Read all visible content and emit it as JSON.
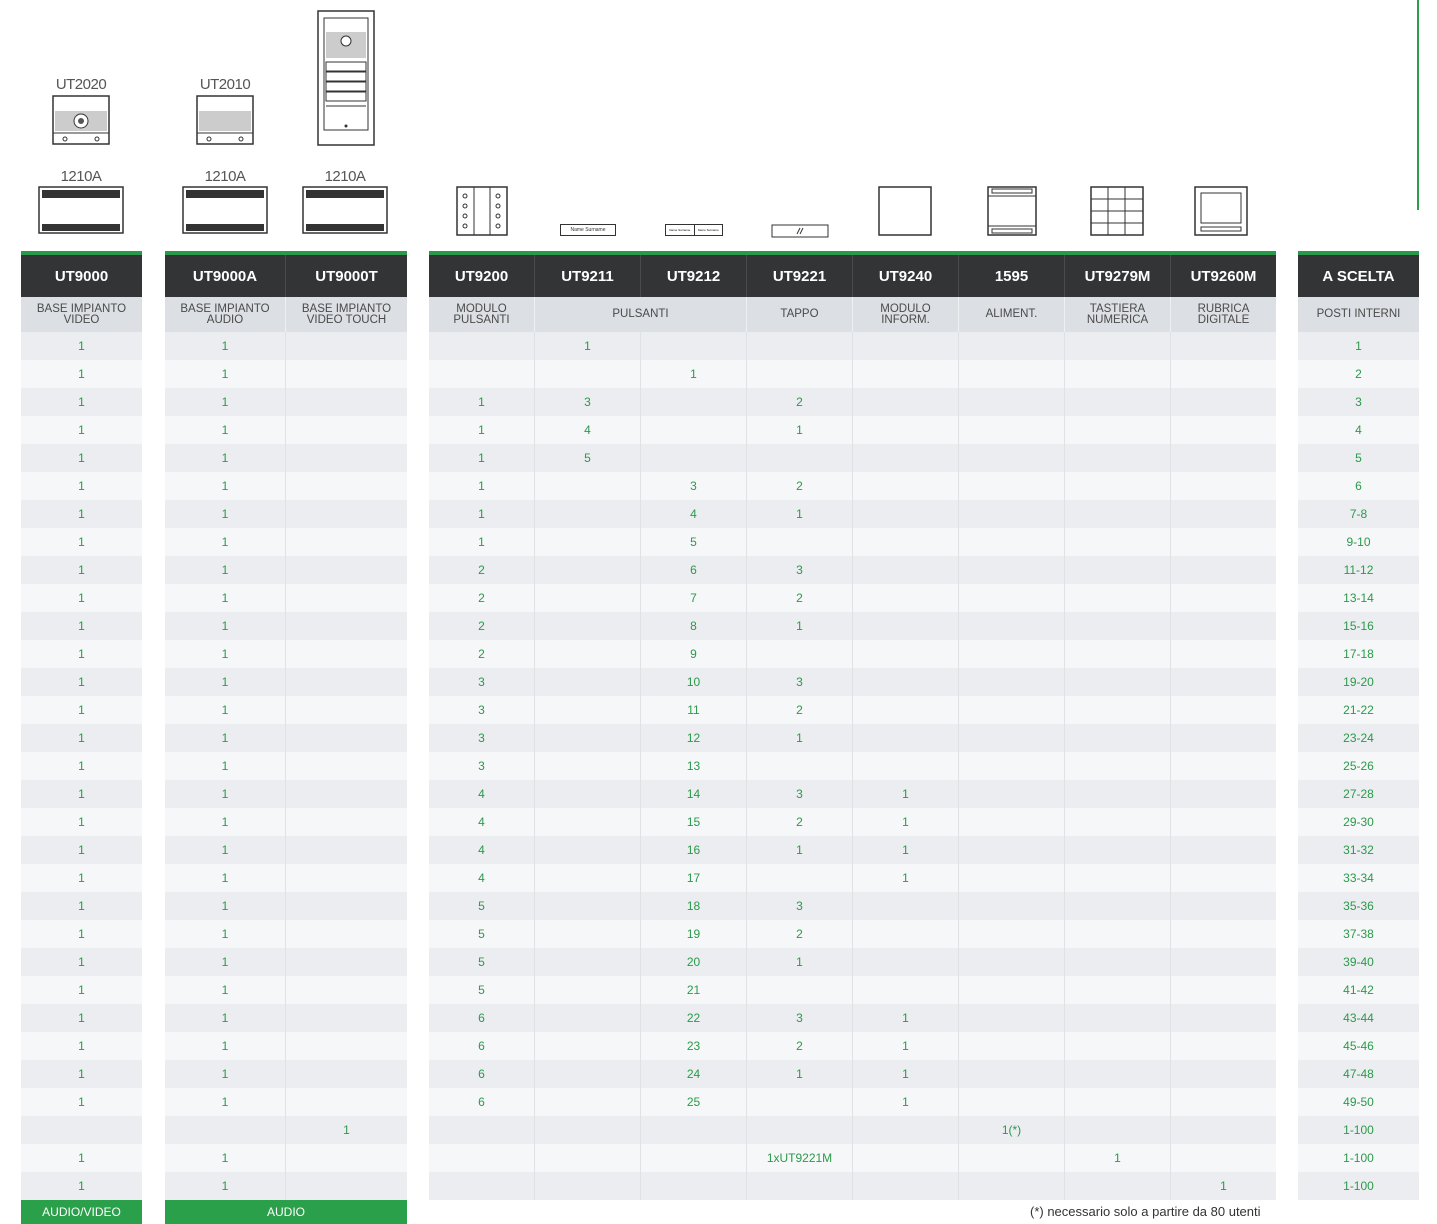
{
  "products_top": {
    "p1_label": "UT2020",
    "p2_label": "UT2010",
    "ps1": "1210A",
    "ps2": "1210A",
    "ps3": "1210A",
    "nameplate": "Name Surname",
    "nameplate_small": "Name Surname"
  },
  "block1": {
    "headers": [
      "UT9000"
    ],
    "subs": [
      "BASE IMPIANTO VIDEO"
    ],
    "rows": [
      [
        "1"
      ],
      [
        "1"
      ],
      [
        "1"
      ],
      [
        "1"
      ],
      [
        "1"
      ],
      [
        "1"
      ],
      [
        "1"
      ],
      [
        "1"
      ],
      [
        "1"
      ],
      [
        "1"
      ],
      [
        "1"
      ],
      [
        "1"
      ],
      [
        "1"
      ],
      [
        "1"
      ],
      [
        "1"
      ],
      [
        "1"
      ],
      [
        "1"
      ],
      [
        "1"
      ],
      [
        "1"
      ],
      [
        "1"
      ],
      [
        "1"
      ],
      [
        "1"
      ],
      [
        "1"
      ],
      [
        "1"
      ],
      [
        "1"
      ],
      [
        "1"
      ],
      [
        "1"
      ],
      [
        "1"
      ],
      [
        ""
      ],
      [
        "1"
      ],
      [
        "1"
      ]
    ],
    "footer": "AUDIO/VIDEO"
  },
  "block2": {
    "headers": [
      "UT9000A",
      "UT9000T"
    ],
    "subs": [
      "BASE IMPIANTO AUDIO",
      "BASE IMPIANTO VIDEO TOUCH"
    ],
    "rows": [
      [
        "1",
        ""
      ],
      [
        "1",
        ""
      ],
      [
        "1",
        ""
      ],
      [
        "1",
        ""
      ],
      [
        "1",
        ""
      ],
      [
        "1",
        ""
      ],
      [
        "1",
        ""
      ],
      [
        "1",
        ""
      ],
      [
        "1",
        ""
      ],
      [
        "1",
        ""
      ],
      [
        "1",
        ""
      ],
      [
        "1",
        ""
      ],
      [
        "1",
        ""
      ],
      [
        "1",
        ""
      ],
      [
        "1",
        ""
      ],
      [
        "1",
        ""
      ],
      [
        "1",
        ""
      ],
      [
        "1",
        ""
      ],
      [
        "1",
        ""
      ],
      [
        "1",
        ""
      ],
      [
        "1",
        ""
      ],
      [
        "1",
        ""
      ],
      [
        "1",
        ""
      ],
      [
        "1",
        ""
      ],
      [
        "1",
        ""
      ],
      [
        "1",
        ""
      ],
      [
        "1",
        ""
      ],
      [
        "1",
        ""
      ],
      [
        "",
        "1"
      ],
      [
        "1",
        ""
      ],
      [
        "1",
        ""
      ]
    ],
    "footer": "AUDIO"
  },
  "block3": {
    "headers": [
      "UT9200",
      "UT9211",
      "UT9212",
      "UT9221",
      "UT9240",
      "1595",
      "UT9279M",
      "UT9260M"
    ],
    "subs": [
      "MODULO PULSANTI",
      "PULSANTI",
      "TAPPO",
      "MODULO INFORM.",
      "ALIMENT.",
      "TASTIERA NUMERICA",
      "RUBRICA DIGITALE"
    ],
    "rows": [
      [
        "",
        "1",
        "",
        "",
        "",
        "",
        "",
        ""
      ],
      [
        "",
        "",
        "1",
        "",
        "",
        "",
        "",
        ""
      ],
      [
        "1",
        "3",
        "",
        "2",
        "",
        "",
        "",
        ""
      ],
      [
        "1",
        "4",
        "",
        "1",
        "",
        "",
        "",
        ""
      ],
      [
        "1",
        "5",
        "",
        "",
        "",
        "",
        "",
        ""
      ],
      [
        "1",
        "",
        "3",
        "2",
        "",
        "",
        "",
        ""
      ],
      [
        "1",
        "",
        "4",
        "1",
        "",
        "",
        "",
        ""
      ],
      [
        "1",
        "",
        "5",
        "",
        "",
        "",
        "",
        ""
      ],
      [
        "2",
        "",
        "6",
        "3",
        "",
        "",
        "",
        ""
      ],
      [
        "2",
        "",
        "7",
        "2",
        "",
        "",
        "",
        ""
      ],
      [
        "2",
        "",
        "8",
        "1",
        "",
        "",
        "",
        ""
      ],
      [
        "2",
        "",
        "9",
        "",
        "",
        "",
        "",
        ""
      ],
      [
        "3",
        "",
        "10",
        "3",
        "",
        "",
        "",
        ""
      ],
      [
        "3",
        "",
        "11",
        "2",
        "",
        "",
        "",
        ""
      ],
      [
        "3",
        "",
        "12",
        "1",
        "",
        "",
        "",
        ""
      ],
      [
        "3",
        "",
        "13",
        "",
        "",
        "",
        "",
        ""
      ],
      [
        "4",
        "",
        "14",
        "3",
        "1",
        "",
        "",
        ""
      ],
      [
        "4",
        "",
        "15",
        "2",
        "1",
        "",
        "",
        ""
      ],
      [
        "4",
        "",
        "16",
        "1",
        "1",
        "",
        "",
        ""
      ],
      [
        "4",
        "",
        "17",
        "",
        "1",
        "",
        "",
        ""
      ],
      [
        "5",
        "",
        "18",
        "3",
        "",
        "",
        "",
        ""
      ],
      [
        "5",
        "",
        "19",
        "2",
        "",
        "",
        "",
        ""
      ],
      [
        "5",
        "",
        "20",
        "1",
        "",
        "",
        "",
        ""
      ],
      [
        "5",
        "",
        "21",
        "",
        "",
        "",
        "",
        ""
      ],
      [
        "6",
        "",
        "22",
        "3",
        "1",
        "",
        "",
        ""
      ],
      [
        "6",
        "",
        "23",
        "2",
        "1",
        "",
        "",
        ""
      ],
      [
        "6",
        "",
        "24",
        "1",
        "1",
        "",
        "",
        ""
      ],
      [
        "6",
        "",
        "25",
        "",
        "1",
        "",
        "",
        ""
      ],
      [
        "",
        "",
        "",
        "",
        "",
        "1(*)",
        "",
        ""
      ],
      [
        "",
        "",
        "",
        "1xUT9221M",
        "",
        "",
        "1",
        ""
      ],
      [
        "",
        "",
        "",
        "",
        "",
        "",
        "",
        "1"
      ]
    ],
    "note": "(*) necessario solo a partire da 80 utenti"
  },
  "block4": {
    "headers": [
      "A SCELTA"
    ],
    "subs": [
      "POSTI INTERNI"
    ],
    "rows": [
      [
        "1"
      ],
      [
        "2"
      ],
      [
        "3"
      ],
      [
        "4"
      ],
      [
        "5"
      ],
      [
        "6"
      ],
      [
        "7-8"
      ],
      [
        "9-10"
      ],
      [
        "11-12"
      ],
      [
        "13-14"
      ],
      [
        "15-16"
      ],
      [
        "17-18"
      ],
      [
        "19-20"
      ],
      [
        "21-22"
      ],
      [
        "23-24"
      ],
      [
        "25-26"
      ],
      [
        "27-28"
      ],
      [
        "29-30"
      ],
      [
        "31-32"
      ],
      [
        "33-34"
      ],
      [
        "35-36"
      ],
      [
        "37-38"
      ],
      [
        "39-40"
      ],
      [
        "41-42"
      ],
      [
        "43-44"
      ],
      [
        "45-46"
      ],
      [
        "47-48"
      ],
      [
        "49-50"
      ],
      [
        "1-100"
      ],
      [
        "1-100"
      ],
      [
        "1-100"
      ]
    ]
  },
  "colors": {
    "accent": "#2aa04a",
    "header": "#333436",
    "sub": "#dcdfe3"
  }
}
